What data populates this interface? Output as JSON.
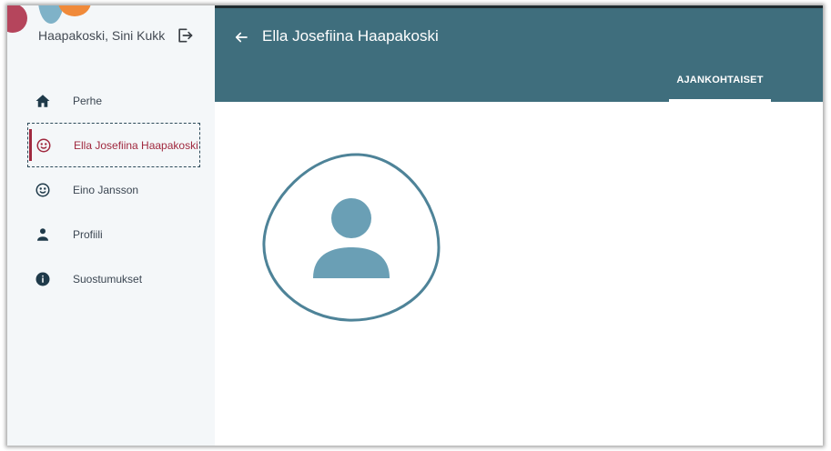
{
  "sidebar": {
    "user_name": "Haapakoski, Sini Kukk…",
    "items": [
      {
        "label": "Perhe",
        "icon": "home-icon"
      },
      {
        "label": "Ella Josefiina Haapakoski",
        "icon": "child-face-icon",
        "active": true
      },
      {
        "label": "Eino Jansson",
        "icon": "child-face-icon"
      },
      {
        "label": "Profiili",
        "icon": "person-icon"
      },
      {
        "label": "Suostumukset",
        "icon": "info-icon"
      }
    ]
  },
  "header": {
    "title": "Ella Josefiina Haapakoski",
    "tab": "AJANKOHTAISET"
  },
  "colors": {
    "header_bg": "#3f6e7d",
    "accent": "#a0293f",
    "avatar": "#6a9fb5"
  }
}
